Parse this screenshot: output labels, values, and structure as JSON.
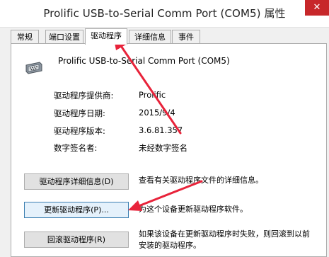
{
  "window": {
    "title": "Prolific USB-to-Serial Comm Port (COM5) 属性",
    "close_glyph": "✕"
  },
  "tabs": [
    {
      "label": "常规",
      "active": false
    },
    {
      "label": "端口设置",
      "active": false
    },
    {
      "label": "驱动程序",
      "active": true
    },
    {
      "label": "详细信息",
      "active": false
    },
    {
      "label": "事件",
      "active": false
    }
  ],
  "device": {
    "name": "Prolific USB-to-Serial Comm Port (COM5)",
    "icon": "serial-port-icon"
  },
  "info": [
    {
      "label": "驱动程序提供商:",
      "value": "Prolific"
    },
    {
      "label": "驱动程序日期:",
      "value": "2015/9/4"
    },
    {
      "label": "驱动程序版本:",
      "value": "3.6.81.357"
    },
    {
      "label": "数字签名者:",
      "value": "未经数字签名"
    }
  ],
  "actions": [
    {
      "label": "驱动程序详细信息(D)",
      "description": "查看有关驱动程序文件的详细信息。"
    },
    {
      "label": "更新驱动程序(P)...",
      "description": "为这个设备更新驱动程序软件。"
    },
    {
      "label": "回滚驱动程序(R)",
      "description": "如果该设备在更新驱动程序时失败，则回滚到以前安装的驱动程序。"
    }
  ],
  "colors": {
    "annotation_arrow": "#e8233a",
    "close_button": "#c7272a"
  }
}
